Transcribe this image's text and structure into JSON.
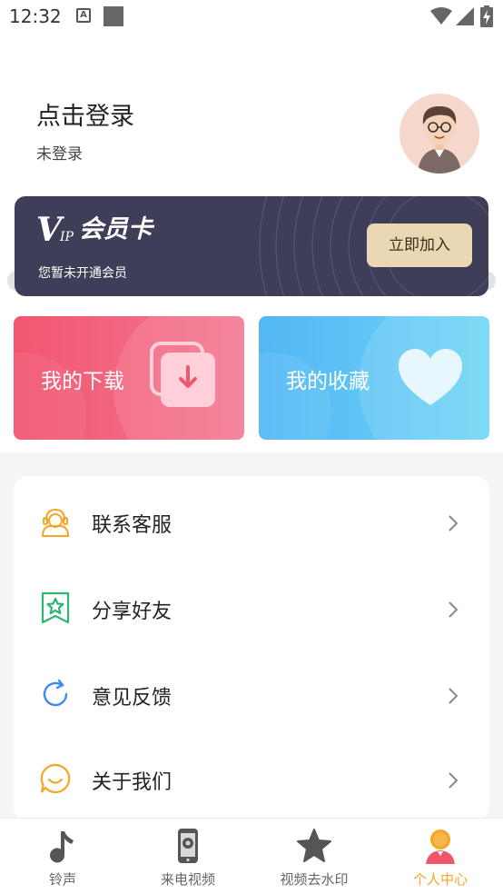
{
  "status_bar": {
    "time": "12:32",
    "notification_icon_letter": "A"
  },
  "profile": {
    "login_title": "点击登录",
    "login_status": "未登录"
  },
  "vip": {
    "logo_letter": "V",
    "logo_sub": "IP",
    "card_name": "会员卡",
    "subtitle": "您暂未开通会员",
    "join_label": "立即加入",
    "join_color": "#ead7b3"
  },
  "tiles": {
    "download_label": "我的下载",
    "favorites_label": "我的收藏",
    "download_color": "#f2566f",
    "favorites_color": "#53b7f5"
  },
  "menu": {
    "items": [
      {
        "label": "联系客服",
        "icon": "customer-service-icon",
        "color": "#f5a623"
      },
      {
        "label": "分享好友",
        "icon": "share-star-icon",
        "color": "#2bb673"
      },
      {
        "label": "意见反馈",
        "icon": "refresh-icon",
        "color": "#3d8bf2"
      },
      {
        "label": "关于我们",
        "icon": "chat-smile-icon",
        "color": "#f5a623"
      }
    ]
  },
  "bottom_nav": {
    "items": [
      {
        "label": "铃声",
        "icon": "music-note-icon"
      },
      {
        "label": "来电视频",
        "icon": "phone-video-icon"
      },
      {
        "label": "视频去水印",
        "icon": "star-icon"
      },
      {
        "label": "个人中心",
        "icon": "user-icon",
        "active": true
      }
    ],
    "active_color": "#f5a623"
  }
}
